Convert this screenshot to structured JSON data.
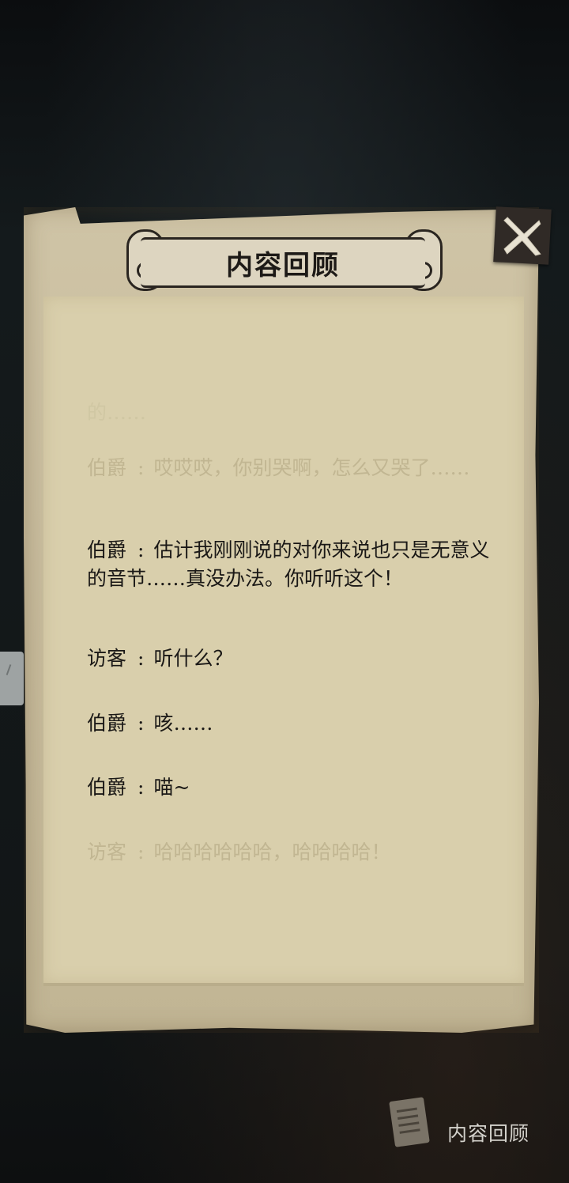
{
  "panel": {
    "title": "内容回顾"
  },
  "log": [
    {
      "speaker": "",
      "text": "的……",
      "state": "top-fade"
    },
    {
      "speaker": "伯爵",
      "text": "哎哎哎，你别哭啊，怎么又哭了……",
      "state": "faded"
    },
    {
      "speaker": "伯爵",
      "text": "估计我刚刚说的对你来说也只是无意义的音节……真没办法。你听听这个！",
      "state": "normal"
    },
    {
      "speaker": "访客",
      "text": "听什么？",
      "state": "normal"
    },
    {
      "speaker": "伯爵",
      "text": "咳……",
      "state": "normal"
    },
    {
      "speaker": "伯爵",
      "text": "喵~",
      "state": "normal"
    },
    {
      "speaker": "访客",
      "text": "哈哈哈哈哈哈，哈哈哈哈！",
      "state": "faded"
    }
  ],
  "review_button": {
    "label": "内容回顾",
    "icon": "document-icon"
  },
  "close_button": {
    "icon": "close-icon"
  },
  "colors": {
    "parchment": "#c7bb9c",
    "paper": "#d9cfac",
    "text": "#1a1816",
    "faded_text": "#c1b692"
  }
}
